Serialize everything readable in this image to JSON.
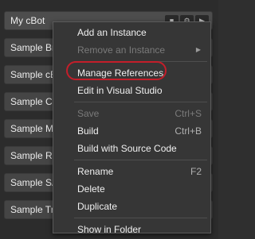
{
  "bots": {
    "items": [
      {
        "label": "My cBot",
        "selected": true
      },
      {
        "label": "Sample Bre"
      },
      {
        "label": "Sample cBo"
      },
      {
        "label": "Sample Clo"
      },
      {
        "label": "Sample Ma"
      },
      {
        "label": "Sample RSI"
      },
      {
        "label": "Sample SA"
      },
      {
        "label": "Sample Tre"
      }
    ]
  },
  "context_menu": {
    "add_instance": "Add an Instance",
    "remove_instance": "Remove an Instance",
    "manage_references": "Manage References",
    "edit_vs": "Edit in Visual Studio",
    "save": "Save",
    "save_shortcut": "Ctrl+S",
    "build": "Build",
    "build_shortcut": "Ctrl+B",
    "build_source": "Build with Source Code",
    "rename": "Rename",
    "rename_shortcut": "F2",
    "delete": "Delete",
    "duplicate": "Duplicate",
    "show_folder": "Show in Folder"
  },
  "colors": {
    "highlight_ring": "#c41e2a",
    "menu_bg": "#363636",
    "disabled_text": "#7a7a7a"
  },
  "icons": {
    "submenu": "chevron-right-icon",
    "bot_actions": [
      "stop-icon",
      "cbot-icon",
      "play-icon"
    ]
  }
}
